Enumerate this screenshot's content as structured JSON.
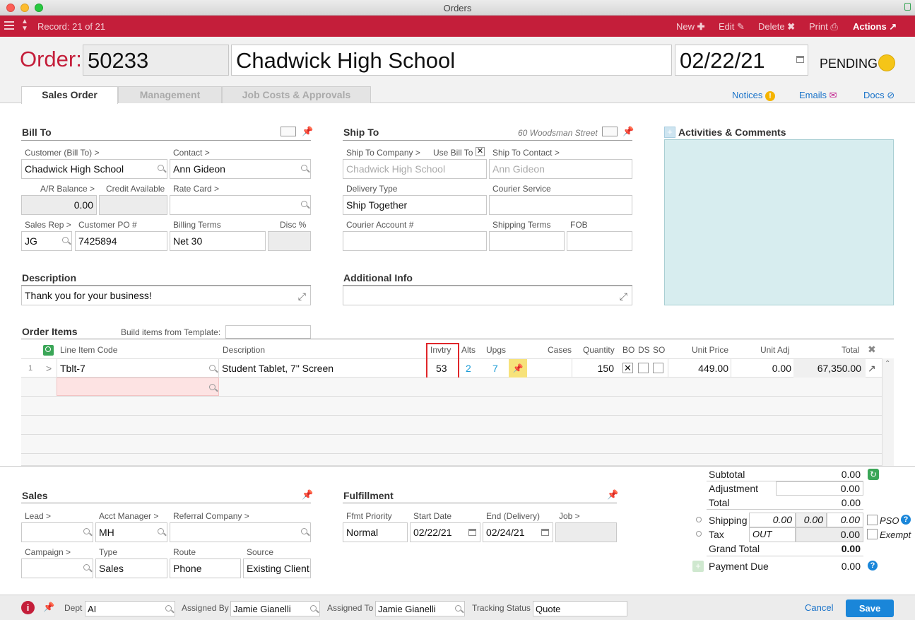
{
  "window": {
    "title": "Orders"
  },
  "toolbar": {
    "record": "Record: 21 of 21",
    "new_label": "New",
    "edit_label": "Edit",
    "delete_label": "Delete",
    "print_label": "Print",
    "actions_label": "Actions"
  },
  "order": {
    "label": "Order:",
    "number": "50233",
    "customer": "Chadwick High School",
    "date": "02/22/21",
    "status": "PENDING",
    "status_color": "#f5c518"
  },
  "tabs": [
    "Sales Order",
    "Management",
    "Job Costs & Approvals"
  ],
  "header_links": {
    "notices": "Notices",
    "emails": "Emails",
    "docs": "Docs"
  },
  "bill_to": {
    "title": "Bill To",
    "customer_label": "Customer (Bill To) >",
    "customer": "Chadwick High School",
    "contact_label": "Contact >",
    "contact": "Ann Gideon",
    "ar_balance_label": "A/R Balance >",
    "ar_balance": "0.00",
    "credit_label": "Credit Available",
    "credit": "",
    "rate_card_label": "Rate Card >",
    "rate_card": "",
    "sales_rep_label": "Sales Rep >",
    "sales_rep": "JG",
    "customer_po_label": "Customer PO #",
    "customer_po": "7425894",
    "billing_terms_label": "Billing Terms",
    "billing_terms": "Net 30",
    "disc_label": "Disc %",
    "disc": ""
  },
  "ship_to": {
    "title": "Ship To",
    "address": "60 Woodsman Street",
    "company_label": "Ship To Company >",
    "use_bill_to_label": "Use Bill To",
    "company": "Chadwick High School",
    "contact_label": "Ship To Contact >",
    "contact": "Ann Gideon",
    "delivery_type_label": "Delivery Type",
    "delivery_type": "Ship Together",
    "courier_service_label": "Courier Service",
    "courier_service": "",
    "courier_account_label": "Courier Account #",
    "shipping_terms_label": "Shipping Terms",
    "fob_label": "FOB"
  },
  "activities": {
    "title": "Activities & Comments"
  },
  "description": {
    "title": "Description",
    "text": "Thank you for your business!"
  },
  "additional_info": {
    "title": "Additional Info",
    "text": ""
  },
  "order_items": {
    "title": "Order Items",
    "template_label": "Build items from Template:",
    "columns": {
      "code": "Line Item Code",
      "description": "Description",
      "inventory": "Invtry",
      "alts": "Alts",
      "upgs": "Upgs",
      "cases": "Cases",
      "quantity": "Quantity",
      "bo": "BO",
      "ds": "DS",
      "so": "SO",
      "unit_price": "Unit Price",
      "unit_adj": "Unit Adj",
      "total": "Total"
    },
    "rows": [
      {
        "num": "1",
        "code": "Tblt-7",
        "description": "Student Tablet, 7\" Screen",
        "inventory": "53",
        "alts": "2",
        "upgs": "7",
        "cases": "",
        "quantity": "150",
        "bo": "✕",
        "unit_price": "449.00",
        "unit_adj": "0.00",
        "total": "67,350.00"
      }
    ]
  },
  "sales": {
    "title": "Sales",
    "lead_label": "Lead >",
    "lead": "",
    "acct_manager_label": "Acct Manager >",
    "acct_manager": "MH",
    "referral_label": "Referral Company >",
    "referral": "",
    "campaign_label": "Campaign >",
    "campaign": "",
    "type_label": "Type",
    "type": "Sales",
    "route_label": "Route",
    "route": "Phone",
    "source_label": "Source",
    "source": "Existing Client"
  },
  "fulfillment": {
    "title": "Fulfillment",
    "priority_label": "Ffmt Priority",
    "priority": "Normal",
    "start_label": "Start Date",
    "start": "02/22/21",
    "end_label": "End (Delivery)",
    "end": "02/24/21",
    "job_label": "Job >",
    "job": ""
  },
  "totals": {
    "subtotal_label": "Subtotal",
    "subtotal": "0.00",
    "adjustment_label": "Adjustment",
    "adjustment": "0.00",
    "total_label": "Total",
    "total": "0.00",
    "shipping_label": "Shipping",
    "shipping_a": "0.00",
    "shipping_b": "0.00",
    "pso_label": "PSO",
    "tax_label": "Tax",
    "tax_code": "OUT",
    "tax": "0.00",
    "exempt_label": "Exempt",
    "grand_total_label": "Grand Total",
    "grand_total": "0.00",
    "payment_due_label": "Payment Due",
    "payment_due": "0.00"
  },
  "footer": {
    "dept_label": "Dept",
    "dept": "AI",
    "assigned_by_label": "Assigned By",
    "assigned_by": "Jamie Gianelli",
    "assigned_to_label": "Assigned To",
    "assigned_to": "Jamie Gianelli",
    "tracking_label": "Tracking Status",
    "tracking": "Quote",
    "cancel_label": "Cancel",
    "save_label": "Save"
  },
  "colors": {
    "brand_red": "#c41e3a",
    "link_blue": "#1a73c9",
    "save_blue": "#1a86d9",
    "highlight_red": "#e0262a"
  }
}
